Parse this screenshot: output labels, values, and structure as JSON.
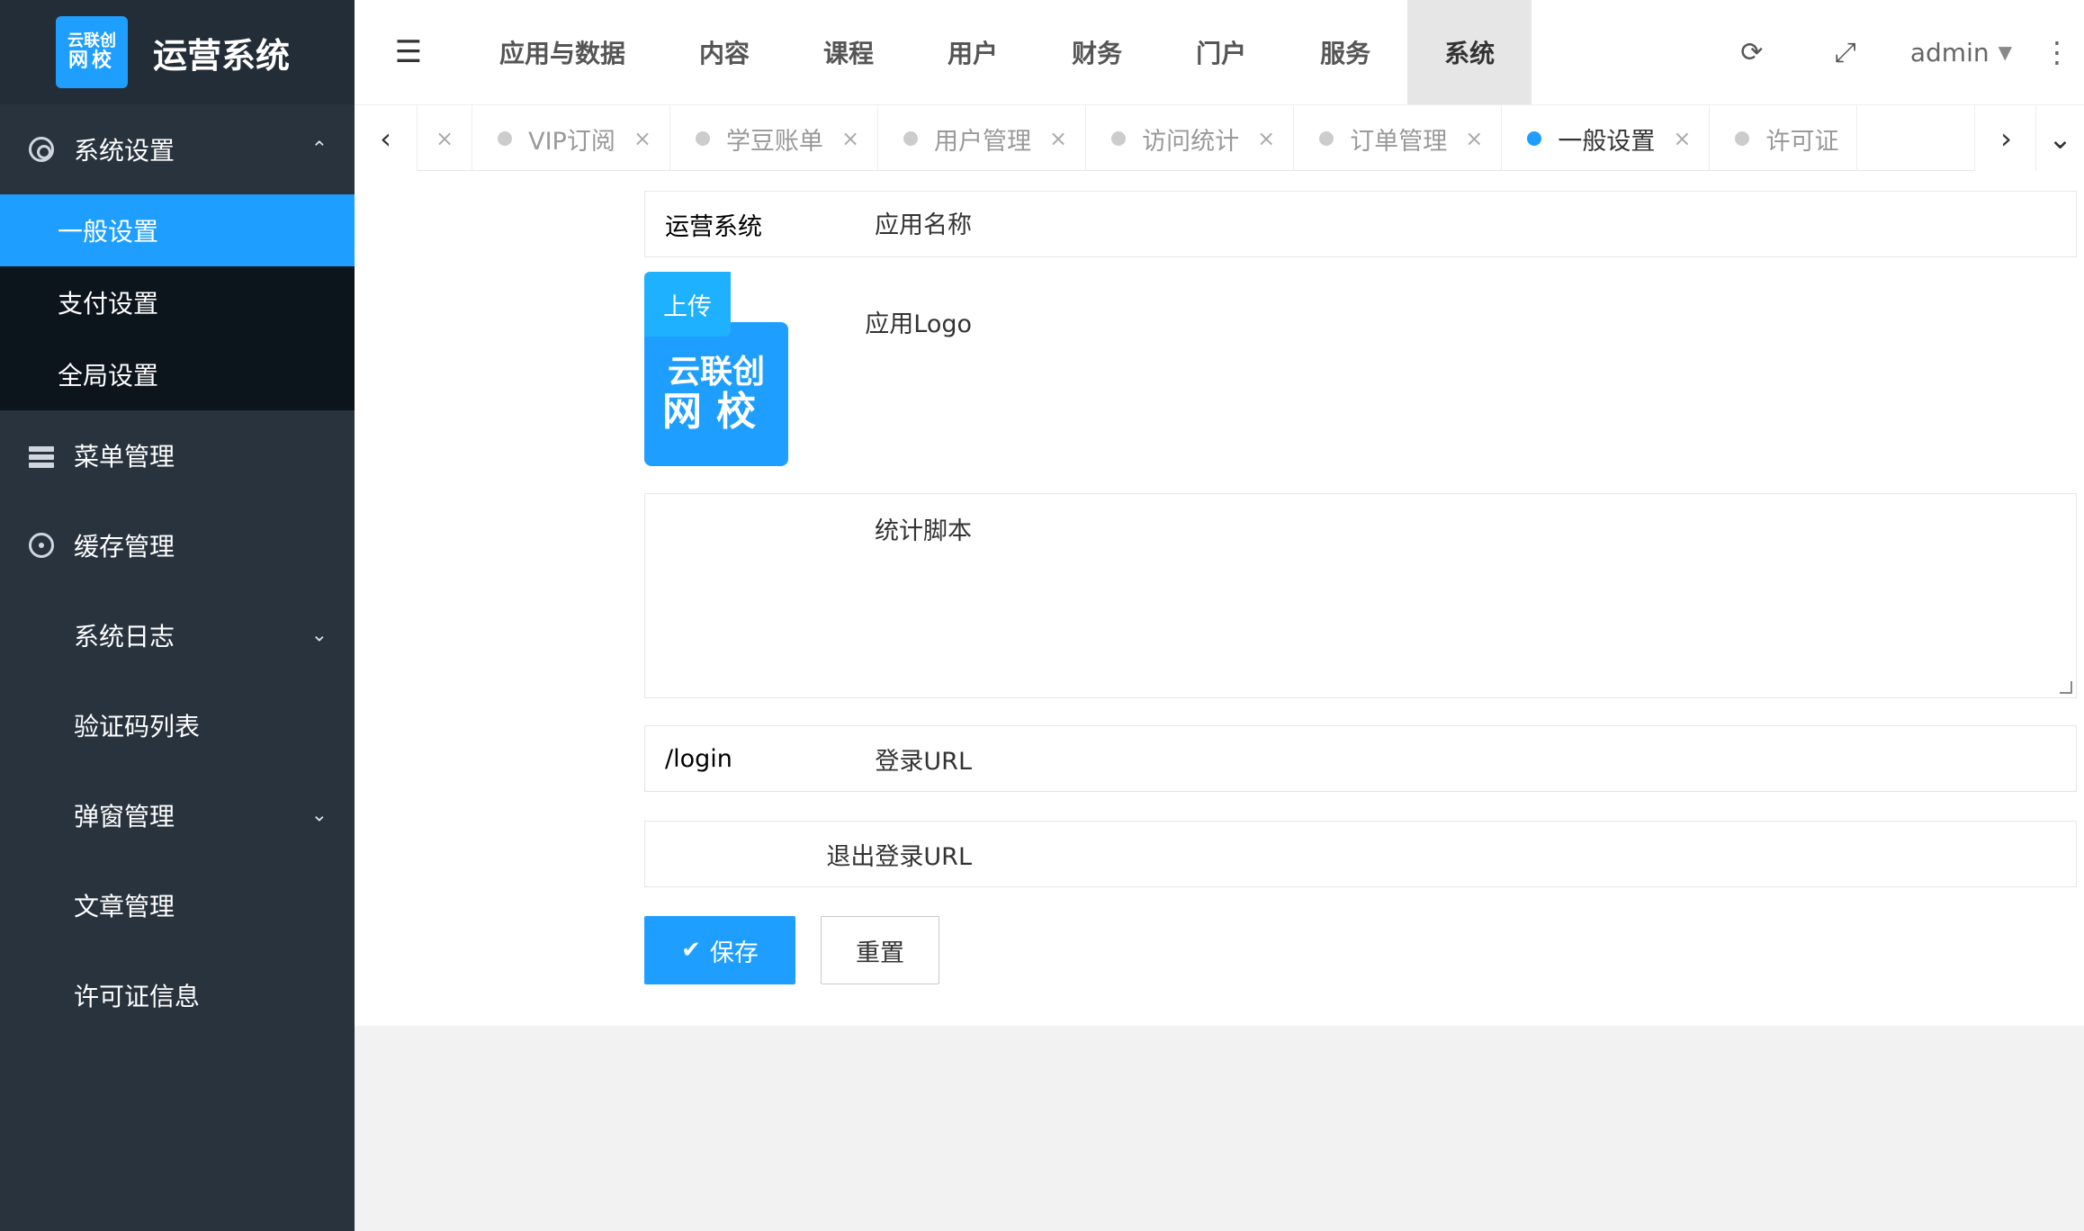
{
  "brand": {
    "logo_line1": "云联创",
    "logo_line2": "网校",
    "title": "运营系统"
  },
  "sidebar": {
    "group_system_settings": "系统设置",
    "sub_items": [
      "一般设置",
      "支付设置",
      "全局设置"
    ],
    "active_sub": "一般设置",
    "menu_management": "菜单管理",
    "cache_management": "缓存管理",
    "items": [
      "系统日志",
      "验证码列表",
      "弹窗管理",
      "文章管理",
      "许可证信息"
    ]
  },
  "header": {
    "nav": [
      "应用与数据",
      "内容",
      "课程",
      "用户",
      "财务",
      "门户",
      "服务",
      "系统"
    ],
    "active_nav": "系统",
    "user": "admin"
  },
  "tabs": [
    {
      "label": "VIP订阅",
      "active": false
    },
    {
      "label": "学豆账单",
      "active": false
    },
    {
      "label": "用户管理",
      "active": false
    },
    {
      "label": "访问统计",
      "active": false
    },
    {
      "label": "订单管理",
      "active": false
    },
    {
      "label": "一般设置",
      "active": true
    },
    {
      "label": "许可证",
      "active": false
    }
  ],
  "form": {
    "app_name_label": "应用名称",
    "app_name_value": "运营系统",
    "app_logo_label": "应用Logo",
    "upload_label": "上传",
    "logo_line1": "云联创",
    "logo_line2": "网校",
    "script_label": "统计脚本",
    "login_url_label": "登录URL",
    "login_url_value": "/login",
    "logout_url_label": "退出登录URL",
    "logout_url_value": "",
    "save_label": "保存",
    "reset_label": "重置"
  }
}
